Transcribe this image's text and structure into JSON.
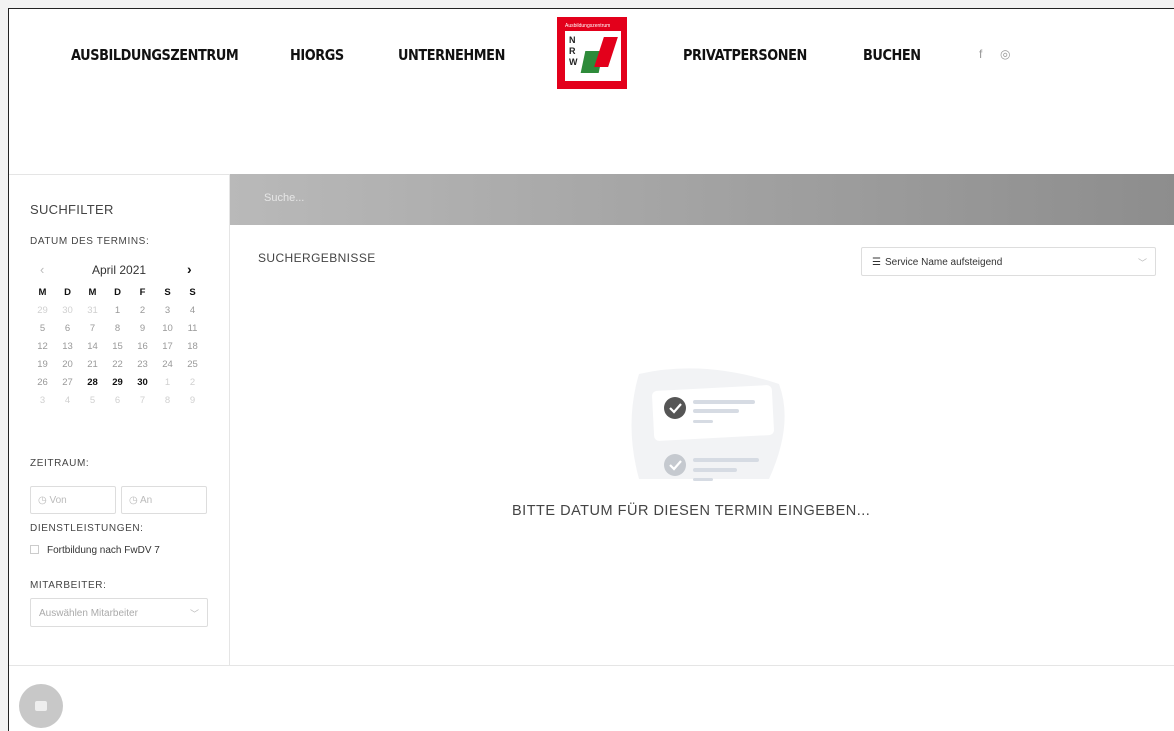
{
  "nav": {
    "ausbildungszentrum": "AUSBILDUNGSZENTRUM",
    "hiorgs": "HIORGS",
    "unternehmen": "UNTERNEHMEN",
    "privatpersonen": "PRIVATPERSONEN",
    "buchen": "BUCHEN",
    "facebook_icon": "f",
    "instagram_icon": "◎",
    "logo_text": "Ausbildungszentrum",
    "logo_nrw": "N R W"
  },
  "search": {
    "placeholder": "Suche..."
  },
  "sidebar": {
    "title": "SUCHFILTER",
    "date_label": "DATUM DES TERMINS:",
    "calendar": {
      "prev": "‹",
      "month": "April 2021",
      "next": "›",
      "weekdays": [
        "M",
        "D",
        "M",
        "D",
        "F",
        "S",
        "S"
      ],
      "days": [
        {
          "n": "29",
          "s": "o"
        },
        {
          "n": "30",
          "s": "o"
        },
        {
          "n": "31",
          "s": "o"
        },
        {
          "n": "1",
          "s": ""
        },
        {
          "n": "2",
          "s": ""
        },
        {
          "n": "3",
          "s": ""
        },
        {
          "n": "4",
          "s": ""
        },
        {
          "n": "5",
          "s": ""
        },
        {
          "n": "6",
          "s": ""
        },
        {
          "n": "7",
          "s": ""
        },
        {
          "n": "8",
          "s": ""
        },
        {
          "n": "9",
          "s": ""
        },
        {
          "n": "10",
          "s": ""
        },
        {
          "n": "11",
          "s": ""
        },
        {
          "n": "12",
          "s": ""
        },
        {
          "n": "13",
          "s": ""
        },
        {
          "n": "14",
          "s": ""
        },
        {
          "n": "15",
          "s": ""
        },
        {
          "n": "16",
          "s": ""
        },
        {
          "n": "17",
          "s": ""
        },
        {
          "n": "18",
          "s": ""
        },
        {
          "n": "19",
          "s": ""
        },
        {
          "n": "20",
          "s": ""
        },
        {
          "n": "21",
          "s": ""
        },
        {
          "n": "22",
          "s": ""
        },
        {
          "n": "23",
          "s": ""
        },
        {
          "n": "24",
          "s": ""
        },
        {
          "n": "25",
          "s": ""
        },
        {
          "n": "26",
          "s": ""
        },
        {
          "n": "27",
          "s": ""
        },
        {
          "n": "28",
          "s": "a"
        },
        {
          "n": "29",
          "s": "a"
        },
        {
          "n": "30",
          "s": "a"
        },
        {
          "n": "1",
          "s": "o"
        },
        {
          "n": "2",
          "s": "o"
        },
        {
          "n": "3",
          "s": "o"
        },
        {
          "n": "4",
          "s": "o"
        },
        {
          "n": "5",
          "s": "o"
        },
        {
          "n": "6",
          "s": "o"
        },
        {
          "n": "7",
          "s": "o"
        },
        {
          "n": "8",
          "s": "o"
        },
        {
          "n": "9",
          "s": "o"
        }
      ]
    },
    "zeitraum_label": "ZEITRAUM:",
    "von_placeholder": "◷ Von",
    "an_placeholder": "◷ An",
    "dienst_label": "DIENSTLEISTUNGEN:",
    "dienst_option": "Fortbildung nach FwDV 7",
    "mitarbeiter_label": "MITARBEITER:",
    "mitarbeiter_placeholder": "Auswählen Mitarbeiter"
  },
  "main": {
    "results_title": "SUCHERGEBNISSE",
    "sort_value": "Service Name aufsteigend",
    "empty_message": "BITTE DATUM FÜR DIESEN TERMIN EINGEBEN..."
  }
}
